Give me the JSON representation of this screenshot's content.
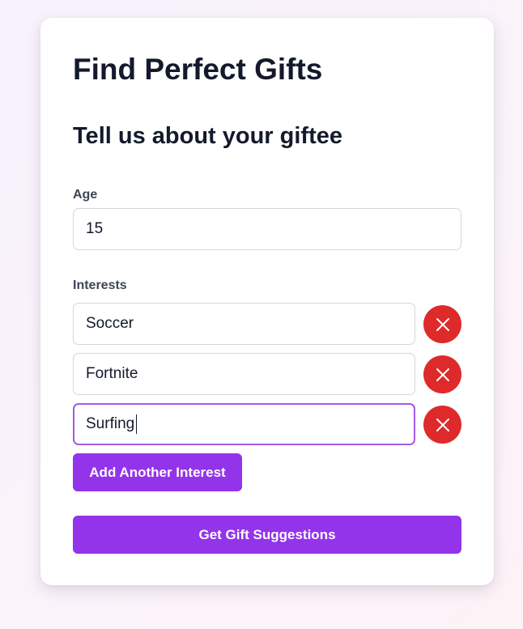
{
  "header": {
    "title": "Find Perfect Gifts",
    "subtitle": "Tell us about your giftee"
  },
  "age": {
    "label": "Age",
    "value": "15"
  },
  "interests": {
    "label": "Interests",
    "items": [
      {
        "value": "Soccer"
      },
      {
        "value": "Fortnite"
      },
      {
        "value": "Surfing",
        "focused": true
      }
    ],
    "remove_icon": "close-icon",
    "add_label": "Add Another Interest"
  },
  "submit": {
    "label": "Get Gift Suggestions"
  },
  "colors": {
    "accent": "#9333ea",
    "focus_border": "#a35ae8",
    "danger": "#de2a2a",
    "heading": "#131a2c",
    "label": "#3f4656"
  }
}
